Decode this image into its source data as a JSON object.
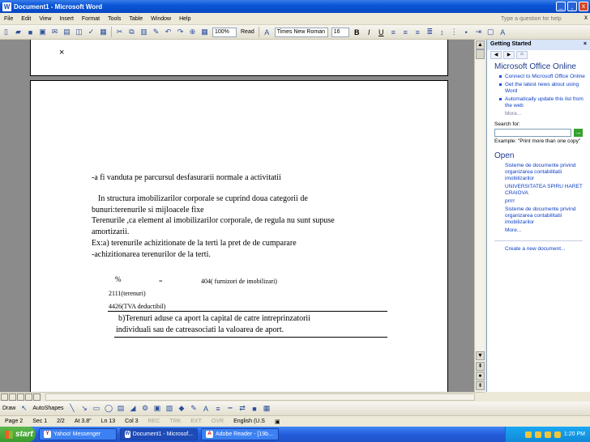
{
  "window": {
    "title": "Document1 - Microsoft Word",
    "min": "_",
    "max": "¸",
    "close": "x"
  },
  "menu": {
    "items": [
      "File",
      "Edit",
      "View",
      "Insert",
      "Format",
      "Tools",
      "Table",
      "Window",
      "Help"
    ],
    "help_placeholder": "Type a question for help",
    "close": "x"
  },
  "toolbar": {
    "zoom": "100%",
    "read": "Read",
    "font": "Times New Roman",
    "size": "16"
  },
  "document": {
    "line1": "-a fi vanduta pe parcursul desfasurarii normale a activitatii",
    "line2": "In structura imobilizarilor corporale se cuprind doua categorii de",
    "line3": "bunuri:terenurile si mijloacele fixe",
    "line4": "Terenurile ,ca element al imobilizarilor corporale, de regula nu sunt supuse",
    "line5": "amortizarii.",
    "line6": "Ex:a) terenurile achizitionate de la terti la pret de de cumparare",
    "line7": "-achizitionarea terenurilor de la terti.",
    "pct": "%",
    "eq": "=",
    "acct404": "404( furnizori de imobilizari)",
    "acct2111": "2111(terenuri)",
    "acct4426": "4426(TVA deductibil)",
    "line8": "b)Terenuri aduse ca aport la capital de catre intreprinzatorii",
    "line9": "individuali sau de catreasociati la valoarea de aport."
  },
  "taskpane": {
    "header": "Getting Started",
    "title": "Microsoft Office Online",
    "links": [
      "Connect to Microsoft Office Online",
      "Get the latest news about using Word",
      "Automatically update this list from the web"
    ],
    "more": "More...",
    "search_label": "Search for:",
    "example": "Example: \"Print more than one copy\"",
    "open_title": "Open",
    "files": [
      "Sisteme de documente privind organizarea contabilitatii imobilizarilor",
      "UNIVERSITATEA SPIRU HARET CRAIOVA",
      "prrrr",
      "Sisteme de documente privind organizarea contabilitatii imobilizarilor"
    ],
    "open_more": "More...",
    "create": "Create a new document..."
  },
  "drawbar": {
    "draw": "Draw",
    "autoshapes": "AutoShapes"
  },
  "status": {
    "page": "Page 2",
    "sec": "Sec 1",
    "pages": "2/2",
    "at": "At 3.8\"",
    "ln": "Ln 13",
    "col": "Col 3",
    "rec": "REC",
    "trk": "TRK",
    "ext": "EXT",
    "ovr": "OVR",
    "lang": "English (U.S"
  },
  "taskbar": {
    "start": "start",
    "tasks": [
      "Yahoo! Messenger",
      "Document1 - Microsof...",
      "Adobe Reader - [19b..."
    ],
    "clock": "1:20 PM"
  }
}
